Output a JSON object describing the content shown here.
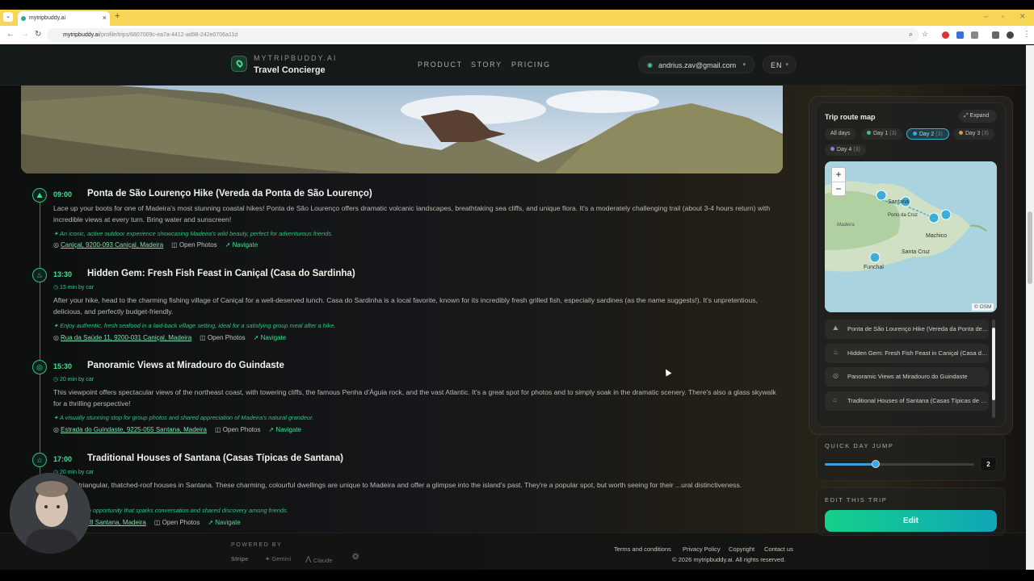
{
  "browser": {
    "tab_title": "mytripbuddy.ai",
    "url_domain": "mytripbuddy.ai",
    "url_path": "/profile/trips/6807009c-ea7a-4412-ad98-242e0706a11d"
  },
  "header": {
    "brand_top": "MYTRIPBUDDY.AI",
    "brand_sub": "Travel Concierge",
    "nav": [
      "PRODUCT",
      "STORY",
      "PRICING"
    ],
    "account_email": "andrius.zav@gmail.com",
    "language": "EN"
  },
  "timeline": [
    {
      "time": "09:00",
      "icon": "mountain-icon",
      "title": "Ponta de São Lourenço Hike (Vereda da Ponta de São Lourenço)",
      "travel": "",
      "description": "Lace up your boots for one of Madeira's most stunning coastal hikes! Ponta de São Lourenço offers dramatic volcanic landscapes, breathtaking sea cliffs, and unique flora. It's a moderately challenging trail (about 3-4 hours return) with incredible views at every turn. Bring water and sunscreen!",
      "tip": "✦ An iconic, active outdoor experience showcasing Madeira's wild beauty, perfect for adventurous friends.",
      "address": "Caniçal, 9200-093 Caniçal, Madeira",
      "photos_label": "Open Photos",
      "navigate_label": "Navigate"
    },
    {
      "time": "13:30",
      "icon": "fork-knife-icon",
      "title": "Hidden Gem: Fresh Fish Feast in Caniçal (Casa do Sardinha)",
      "travel": "◷ 15 min by car",
      "description": "After your hike, head to the charming fishing village of Caniçal for a well-deserved lunch. Casa do Sardinha is a local favorite, known for its incredibly fresh grilled fish, especially sardines (as the name suggests!). It's unpretentious, delicious, and perfectly budget-friendly.",
      "tip": "✦ Enjoy authentic, fresh seafood in a laid-back village setting, ideal for a satisfying group meal after a hike.",
      "address": "Rua da Saúde 11, 9200-031 Caniçal, Madeira",
      "photos_label": "Open Photos",
      "navigate_label": "Navigate"
    },
    {
      "time": "15:30",
      "icon": "binoculars-icon",
      "title": "Panoramic Views at Miradouro do Guindaste",
      "travel": "◷ 20 min by car",
      "description": "This viewpoint offers spectacular views of the northeast coast, with towering cliffs, the famous Penha d'Águia rock, and the vast Atlantic. It's a great spot for photos and to simply soak in the dramatic scenery. There's also a glass skywalk for a thrilling perspective!",
      "tip": "✦ A visually stunning stop for group photos and shared appreciation of Madeira's natural grandeur.",
      "address": "Estrada do Guindaste, 9225-055 Santana, Madeira",
      "photos_label": "Open Photos",
      "navigate_label": "Navigate"
    },
    {
      "time": "17:00",
      "icon": "landmark-icon",
      "title": "Traditional Houses of Santana (Casas Típicas de Santana)",
      "travel": "◷ 20 min by car",
      "description": "...iconic triangular, thatched-roof houses in Santana. These charming, colourful dwellings are unique to Madeira and offer a glimpse into the island's past. They're a popular spot, but worth seeing for their ...ural distinctiveness.",
      "tip": "...ultural photo opportunity that sparks conversation and shared discovery among friends.",
      "address": "...9230-018 Santana, Madeira",
      "photos_label": "Open Photos",
      "navigate_label": "Navigate"
    }
  ],
  "route_map": {
    "title": "Trip route map",
    "expand_label": "Expand",
    "chips": [
      {
        "label": "All days",
        "count": "",
        "color": ""
      },
      {
        "label": "Day 1",
        "count": "(3)",
        "color": "#3ec48a"
      },
      {
        "label": "Day 2",
        "count": "(3)",
        "color": "#3aaed8"
      },
      {
        "label": "Day 3",
        "count": "(3)",
        "color": "#e0963a"
      },
      {
        "label": "Day 4",
        "count": "(3)",
        "color": "#9a7ad8"
      }
    ],
    "active_chip": "Day 2",
    "map_labels": {
      "santana": "Santana",
      "porto_da_cruz": "Porto da Cruz",
      "machico": "Machico",
      "madeira": "Madeira",
      "santa_cruz": "Santa Cruz",
      "funchal": "Funchal"
    },
    "zoom_in": "+",
    "zoom_out": "−",
    "attribution": "© OSM",
    "places": [
      {
        "icon": "mountain-icon",
        "label": "Ponta de São Lourenço Hike (Vereda da Ponta de São Lourenço)"
      },
      {
        "icon": "fork-knife-icon",
        "label": "Hidden Gem: Fresh Fish Feast in Caniçal (Casa do Sardinha)"
      },
      {
        "icon": "binoculars-icon",
        "label": "Panoramic Views at Miradouro do Guindaste"
      },
      {
        "icon": "landmark-icon",
        "label": "Traditional Houses of Santana (Casas Típicas de Santana)"
      }
    ]
  },
  "quick_day_jump": {
    "label": "QUICK DAY JUMP",
    "value": "2",
    "position": 0.34
  },
  "edit": {
    "label": "EDIT THIS TRIP",
    "button": "Edit"
  },
  "footer": {
    "powered_by": "POWERED BY",
    "sponsors": [
      "Stripe",
      "Gemini",
      "Claude"
    ],
    "links": [
      "Terms and conditions",
      "Privacy Policy",
      "Copyright",
      "Contact us"
    ],
    "copyright": "© 2026 mytripbuddy.ai. All rights reserved."
  },
  "colors": {
    "accent": "#3ee08f",
    "active_day": "#3aaed8",
    "edit_gradient_start": "#14d08a",
    "edit_gradient_end": "#10a6b8"
  }
}
